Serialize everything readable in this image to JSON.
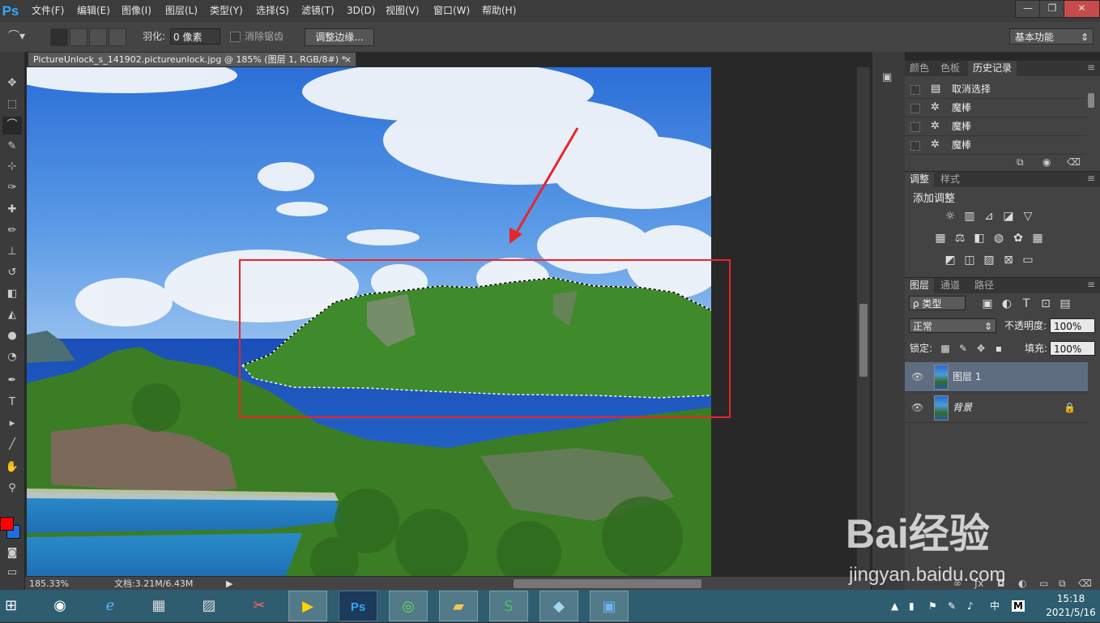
{
  "app": {
    "logo": "Ps"
  },
  "menu": [
    "文件(F)",
    "编辑(E)",
    "图像(I)",
    "图层(L)",
    "类型(Y)",
    "选择(S)",
    "滤镜(T)",
    "3D(D)",
    "视图(V)",
    "窗口(W)",
    "帮助(H)"
  ],
  "window_controls": {
    "minimize": "—",
    "restore": "❐",
    "close": "✕"
  },
  "options": {
    "feather_label": "羽化:",
    "feather_value": "0 像素",
    "antialias_label": "消除锯齿",
    "refine_edge_label": "调整边缘...",
    "workspace": "基本功能"
  },
  "document": {
    "tab_title": "PictureUnlock_s_141902.pictureunlock.jpg @ 185% (图层 1, RGB/8#) *",
    "close_glyph": "×",
    "zoom": "185.33%",
    "doc_size": "文档:3.21M/6.43M"
  },
  "colors": {
    "foreground": "#ff0000",
    "background": "#1e6fd9",
    "annotation": "#e8252b"
  },
  "panels": {
    "history": {
      "tabs": [
        "颜色",
        "色板",
        "历史记录"
      ],
      "items": [
        {
          "icon": "document-icon",
          "label": "取消选择"
        },
        {
          "icon": "magic-wand-icon",
          "label": "魔棒"
        },
        {
          "icon": "magic-wand-icon",
          "label": "魔棒"
        },
        {
          "icon": "magic-wand-icon",
          "label": "魔棒"
        }
      ]
    },
    "adjustments": {
      "tabs": [
        "调整",
        "样式"
      ],
      "title": "添加调整"
    },
    "layers": {
      "tabs": [
        "图层",
        "通道",
        "路径"
      ],
      "filter_label": "ρ 类型",
      "blend_mode": "正常",
      "opacity_label": "不透明度:",
      "opacity_value": "100%",
      "lock_label": "锁定:",
      "fill_label": "填充:",
      "fill_value": "100%",
      "layers": [
        {
          "name": "图层 1",
          "selected": true,
          "locked": false
        },
        {
          "name": "背景",
          "selected": false,
          "locked": true
        }
      ]
    }
  },
  "watermark": {
    "brand": "Bai经验",
    "url": "jingyan.baidu.com"
  },
  "taskbar": {
    "time": "15:18",
    "date": "2021/5/16",
    "ime": "中",
    "apps": [
      "player-icon",
      "photoshop-icon",
      "browser-icon",
      "folder-icon",
      "wps-icon",
      "notes-icon",
      "picture-viewer-icon"
    ]
  }
}
